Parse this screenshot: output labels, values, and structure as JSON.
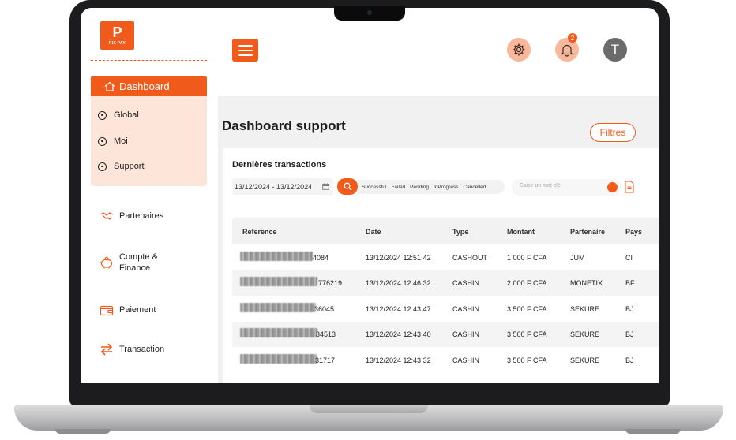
{
  "app": {
    "logo_text": "PIX PAY",
    "logo_mark": "P"
  },
  "sidebar": {
    "dashboard_label": "Dashboard",
    "submenu": [
      {
        "label": "Global"
      },
      {
        "label": "Moi"
      },
      {
        "label": "Support"
      }
    ],
    "items": [
      {
        "label": "Partenaires",
        "icon": "handshake-icon"
      },
      {
        "label": "Compte & Finance",
        "icon": "piggy-bank-icon"
      },
      {
        "label": "Paiement",
        "icon": "wallet-icon"
      },
      {
        "label": "Transaction",
        "icon": "arrows-exchange-icon"
      }
    ]
  },
  "topbar": {
    "notification_count": "2",
    "avatar_initial": "T"
  },
  "page": {
    "title": "Dashboard support",
    "filter_label": "Filtres"
  },
  "transactions": {
    "title": "Dernières transactions",
    "date_range": "13/12/2024 - 13/12/2024",
    "status_filters": [
      "Successful",
      "Failed",
      "Pending",
      "InProgress",
      "Cancelled"
    ],
    "search_placeholder": "Saisir un mot clé",
    "columns": [
      "Reference",
      "Date",
      "Type",
      "Montant",
      "Partenaire",
      "Pays"
    ],
    "rows": [
      {
        "ref_tail": "4084",
        "date": "13/12/2024 12:51:42",
        "type": "CASHOUT",
        "amount": "1 000 F CFA",
        "partner": "JUM",
        "country": "CI"
      },
      {
        "ref_tail": "776219",
        "date": "13/12/2024 12:46:32",
        "type": "CASHIN",
        "amount": "2 000 F CFA",
        "partner": "MONETIX",
        "country": "BF"
      },
      {
        "ref_tail": "36045",
        "date": "13/12/2024 12:43:47",
        "type": "CASHIN",
        "amount": "3 500 F CFA",
        "partner": "SEKURE",
        "country": "BJ"
      },
      {
        "ref_tail": "34513",
        "date": "13/12/2024 12:43:40",
        "type": "CASHIN",
        "amount": "3 500 F CFA",
        "partner": "SEKURE",
        "country": "BJ"
      },
      {
        "ref_tail": "31717",
        "date": "13/12/2024 12:43:32",
        "type": "CASHIN",
        "amount": "3 500 F CFA",
        "partner": "SEKURE",
        "country": "BJ"
      }
    ]
  },
  "colors": {
    "accent": "#f05a1a",
    "accent_soft": "#fde5d9",
    "icon_bg": "#f9b89c"
  }
}
